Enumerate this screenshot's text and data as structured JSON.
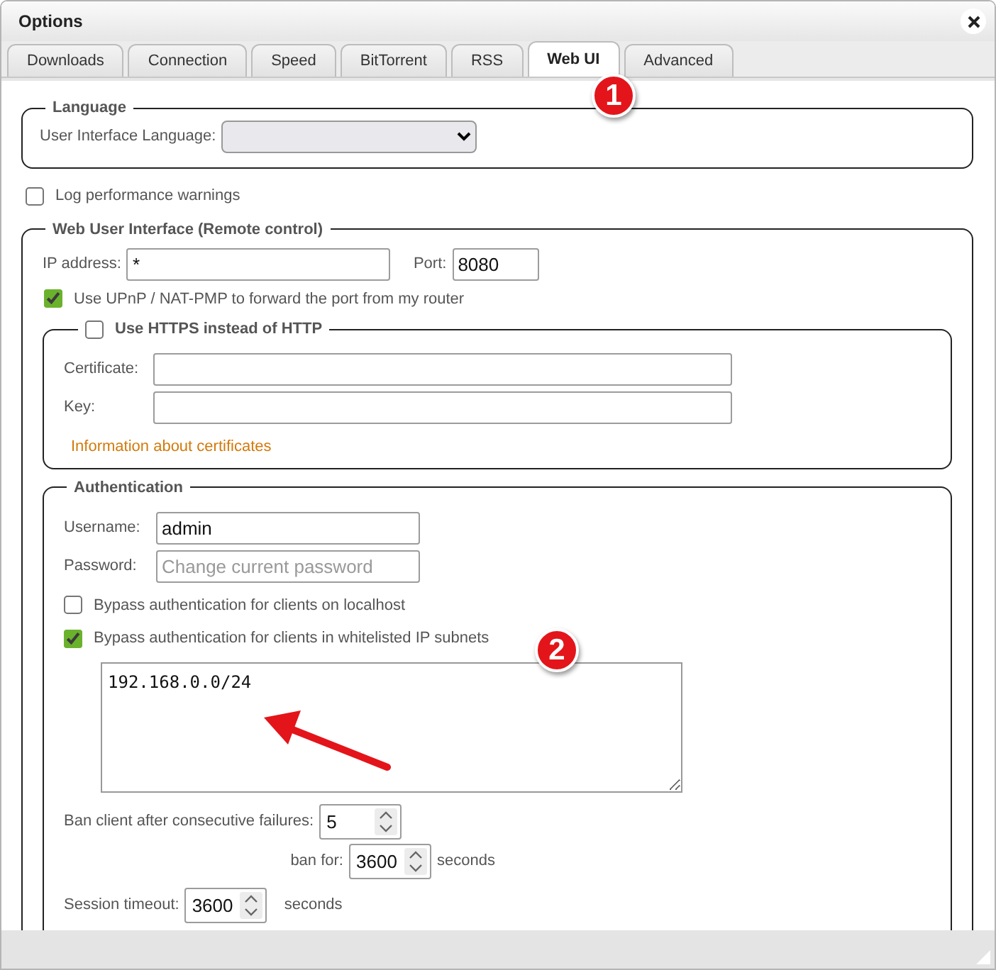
{
  "window": {
    "title": "Options"
  },
  "tabs": [
    {
      "label": "Downloads",
      "selected": false
    },
    {
      "label": "Connection",
      "selected": false
    },
    {
      "label": "Speed",
      "selected": false
    },
    {
      "label": "BitTorrent",
      "selected": false
    },
    {
      "label": "RSS",
      "selected": false
    },
    {
      "label": "Web UI",
      "selected": true
    },
    {
      "label": "Advanced",
      "selected": false
    }
  ],
  "language": {
    "legend": "Language",
    "label": "User Interface Language:"
  },
  "log_performance": {
    "label": "Log performance warnings",
    "checked": false
  },
  "web_ui": {
    "legend": "Web User Interface (Remote control)",
    "ip_label": "IP address:",
    "ip_value": "*",
    "port_label": "Port:",
    "port_value": "8080",
    "upnp": {
      "label": "Use UPnP / NAT-PMP to forward the port from my router",
      "checked": true
    },
    "https": {
      "legend": "Use HTTPS instead of HTTP",
      "checked": false,
      "fields": [
        {
          "label": "Certificate:"
        },
        {
          "label": "Key:"
        }
      ],
      "link": "Information about certificates"
    },
    "authentication": {
      "legend": "Authentication",
      "fields": [
        {
          "label": "Username:",
          "value": "admin"
        },
        {
          "label": "Password:",
          "placeholder": "Change current password"
        }
      ],
      "bypass": [
        {
          "label": "Bypass authentication for clients on localhost",
          "checked": false
        },
        {
          "label": "Bypass authentication for clients in whitelisted IP subnets",
          "checked": true
        }
      ],
      "whitelist": "192.168.0.0/24",
      "ban_failures": {
        "label": "Ban client after consecutive failures:",
        "value": "5"
      },
      "ban_for": {
        "label": "ban for:",
        "value": "3600",
        "unit": "seconds"
      },
      "session_timeout": {
        "label": "Session timeout:",
        "value": "3600",
        "unit": "seconds"
      }
    }
  },
  "annotations": [
    {
      "label": "1"
    },
    {
      "label": "2"
    }
  ]
}
